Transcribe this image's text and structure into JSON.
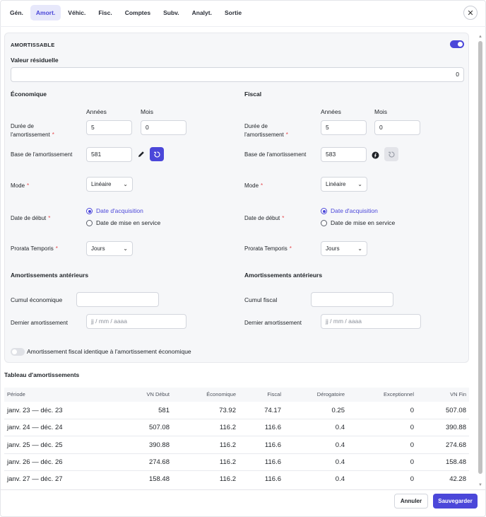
{
  "tabs": [
    {
      "label": "Gén."
    },
    {
      "label": "Amort."
    },
    {
      "label": "Véhic."
    },
    {
      "label": "Fisc."
    },
    {
      "label": "Comptes"
    },
    {
      "label": "Subv."
    },
    {
      "label": "Analyt."
    },
    {
      "label": "Sortie"
    }
  ],
  "close_glyph": "✕",
  "card": {
    "amortissable_label": "AMORTISSABLE",
    "amortissable_on": true,
    "valeur_residuelle_label": "Valeur résiduelle",
    "valeur_residuelle_value": "0"
  },
  "economique": {
    "title": "Économique",
    "annees_label": "Années",
    "mois_label": "Mois",
    "duree_label_1": "Durée de",
    "duree_label_2": "l'amortissement",
    "duree_annees": "5",
    "duree_mois": "0",
    "base_label": "Base de l'amortissement",
    "base_value": "581",
    "mode_label": "Mode",
    "mode_value": "Linéaire",
    "date_debut_label": "Date de début",
    "radio_acquisition": "Date d'acquisition",
    "radio_service": "Date de mise en service",
    "prorata_label": "Prorata Temporis",
    "prorata_value": "Jours",
    "anterieurs_title": "Amortissements antérieurs",
    "cumul_label": "Cumul économique",
    "cumul_value": "",
    "dernier_label": "Dernier amortissement",
    "dernier_placeholder": "jj / mm / aaaa"
  },
  "fiscal": {
    "title": "Fiscal",
    "annees_label": "Années",
    "mois_label": "Mois",
    "duree_label_1": "Durée de",
    "duree_label_2": "l'amortissement",
    "duree_annees": "5",
    "duree_mois": "0",
    "base_label": "Base de l'amortissement",
    "base_value": "583",
    "mode_label": "Mode",
    "mode_value": "Linéaire",
    "date_debut_label": "Date de début",
    "radio_acquisition": "Date d'acquisition",
    "radio_service": "Date de mise en service",
    "prorata_label": "Prorata Temporis",
    "prorata_value": "Jours",
    "anterieurs_title": "Amortissements antérieurs",
    "cumul_label": "Cumul fiscal",
    "cumul_value": "",
    "dernier_label": "Dernier amortissement",
    "dernier_placeholder": "jj / mm / aaaa"
  },
  "identique_label": "Amortissement fiscal identique à l'amortissement économique",
  "required_mark": "*",
  "table": {
    "title": "Tableau d'amortissements",
    "headers": [
      "Période",
      "VN Début",
      "Économique",
      "Fiscal",
      "Dérogatoire",
      "Exceptionnel",
      "VN Fin"
    ],
    "rows": [
      [
        "janv. 23 — déc. 23",
        "581",
        "73.92",
        "74.17",
        "0.25",
        "0",
        "507.08"
      ],
      [
        "janv. 24 — déc. 24",
        "507.08",
        "116.2",
        "116.6",
        "0.4",
        "0",
        "390.88"
      ],
      [
        "janv. 25 — déc. 25",
        "390.88",
        "116.2",
        "116.6",
        "0.4",
        "0",
        "274.68"
      ],
      [
        "janv. 26 — déc. 26",
        "274.68",
        "116.2",
        "116.6",
        "0.4",
        "0",
        "158.48"
      ],
      [
        "janv. 27 — déc. 27",
        "158.48",
        "116.2",
        "116.6",
        "0.4",
        "0",
        "42.28"
      ]
    ]
  },
  "footer": {
    "cancel_label": "Annuler",
    "save_label": "Sauvegarder"
  },
  "colors": {
    "accent": "#4b47d9",
    "required": "#e5484d"
  }
}
